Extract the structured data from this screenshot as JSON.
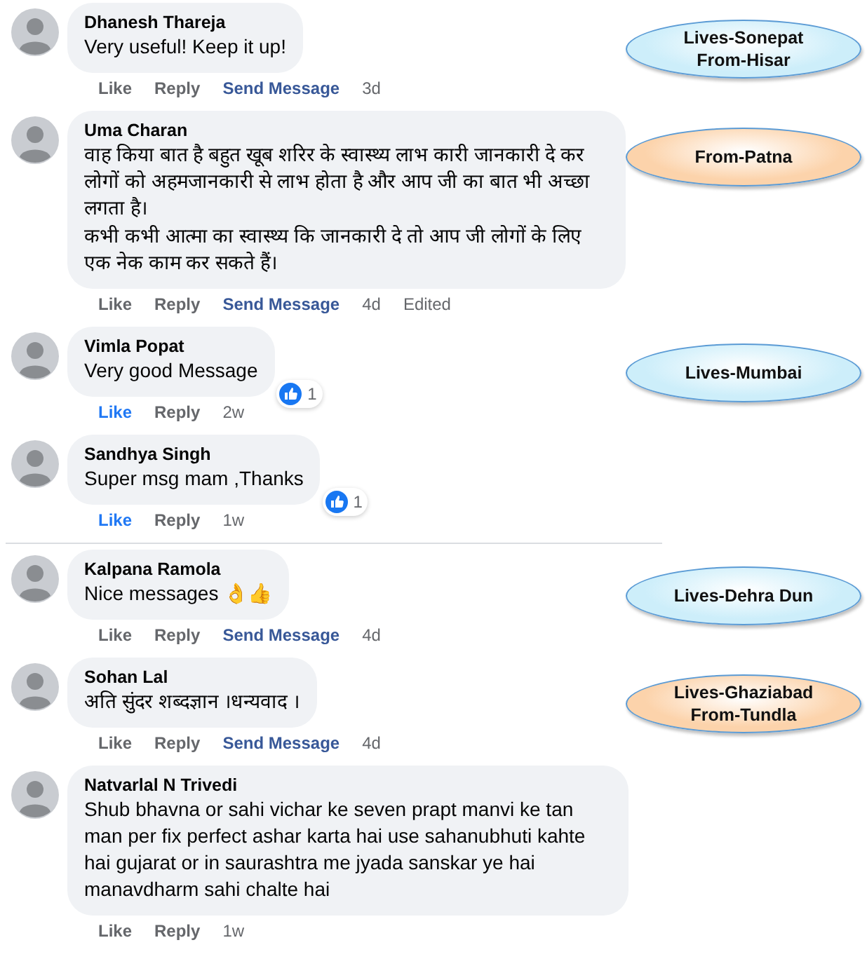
{
  "groups": [
    {
      "comments": [
        {
          "author": "Dhanesh Thareja",
          "text": [
            "Very useful! Keep it up!"
          ],
          "actions": {
            "like": "Like",
            "liked": false,
            "reply": "Reply",
            "send": "Send Message",
            "time": "3d"
          },
          "callout": {
            "lines": [
              "Lives-Sonepat",
              "From-Hisar"
            ],
            "color": "#cdeefa"
          }
        },
        {
          "author": "Uma Charan",
          "text": [
            "वाह किया बात है बहुत खूब शरिर के स्वास्थ्य लाभ कारी जानकारी दे कर लोगों को अहमजानकारी से लाभ होता है और आप जी का बात भी अच्छा लगता है।",
            "कभी कभी आत्मा का स्वास्थ्य कि जानकारी दे तो आप जी लोगों के लिए एक नेक काम कर सकते हैं।"
          ],
          "actions": {
            "like": "Like",
            "liked": false,
            "reply": "Reply",
            "send": "Send Message",
            "time": "4d",
            "edited": "Edited"
          },
          "callout": {
            "lines": [
              "From-Patna"
            ],
            "color": "#fcd3ab"
          }
        },
        {
          "author": "Vimla Popat",
          "text": [
            "Very good Message"
          ],
          "reactions": "1",
          "actions": {
            "like": "Like",
            "liked": true,
            "reply": "Reply",
            "time": "2w"
          },
          "callout": {
            "lines": [
              "Lives-Mumbai"
            ],
            "color": "#cdeefa"
          }
        },
        {
          "author": "Sandhya Singh",
          "text": [
            "Super msg mam ,Thanks"
          ],
          "reactions": "1",
          "actions": {
            "like": "Like",
            "liked": true,
            "reply": "Reply",
            "time": "1w"
          }
        }
      ]
    },
    {
      "comments": [
        {
          "author": "Kalpana Ramola",
          "text": [
            "Nice messages 👌👍"
          ],
          "actions": {
            "like": "Like",
            "liked": false,
            "reply": "Reply",
            "send": "Send Message",
            "time": "4d"
          },
          "callout": {
            "lines": [
              "Lives-Dehra Dun"
            ],
            "color": "#cdeefa"
          }
        },
        {
          "author": "Sohan Lal",
          "text": [
            "अति सुंदर शब्दज्ञान ।धन्यवाद ।"
          ],
          "actions": {
            "like": "Like",
            "liked": false,
            "reply": "Reply",
            "send": "Send Message",
            "time": "4d"
          },
          "callout": {
            "lines": [
              "Lives-Ghaziabad",
              "From-Tundla"
            ],
            "color": "#fcd3ab"
          }
        },
        {
          "author": "Natvarlal N Trivedi",
          "text": [
            "Shub bhavna or sahi vichar ke seven prapt manvi ke tan man per fix perfect ashar karta hai use sahanubhuti kahte hai gujarat or in saurashtra me jyada sanskar ye hai manavdharm sahi chalte hai"
          ],
          "actions": {
            "like": "Like",
            "liked": false,
            "reply": "Reply",
            "time": "1w"
          }
        }
      ]
    }
  ]
}
